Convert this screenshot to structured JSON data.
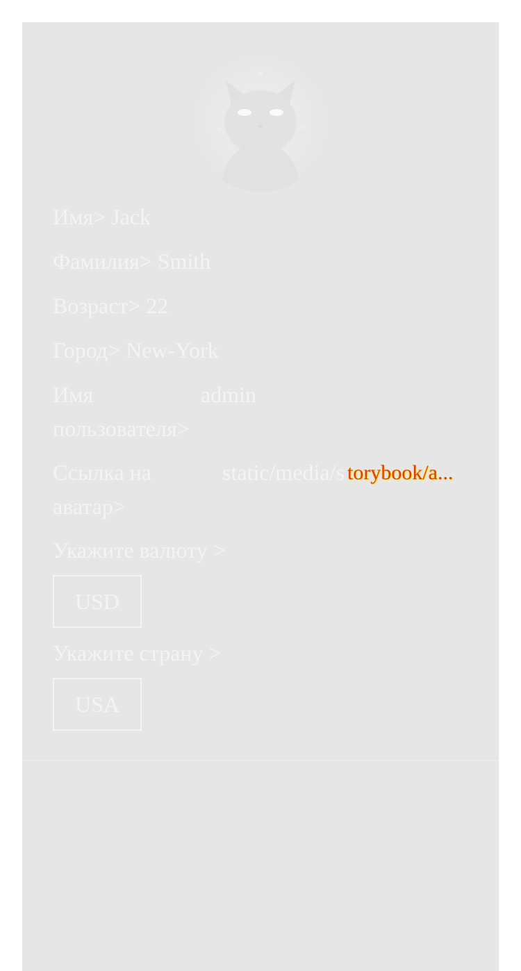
{
  "profile": {
    "first_name_label": "Имя>",
    "first_name": "Jack",
    "last_name_label": "Фамилия>",
    "last_name": "Smith",
    "age_label": "Возраст>",
    "age": "22",
    "city_label": "Город>",
    "city": "New-York",
    "username_label": "Имя пользователя>",
    "username": "admin",
    "avatar_link_label": "Ссылка на аватар>",
    "avatar_link": "static/media/s",
    "avatar_link_overlay": "torybook/a..."
  },
  "currency": {
    "label": "Укажите валюту >",
    "selected": "USD"
  },
  "country": {
    "label": "Укажите страну >",
    "selected": "USA"
  },
  "colors": {
    "card_bg": "#e6e6e6",
    "text": "#f4f4f4",
    "overlay_text": "#e23a12",
    "overlay_outline": "#f5e23a"
  },
  "icons": {
    "avatar": "cat-avatar-image"
  }
}
